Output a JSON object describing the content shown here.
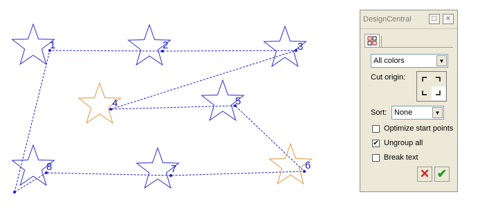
{
  "colors": {
    "blue_star": "#2b2bdb",
    "orange_star": "#e0963c",
    "path": "#1a1ad6",
    "cancel_red": "#d62020",
    "ok_green": "#1e9a1e"
  },
  "stars": [
    {
      "label": "1",
      "color": "blue"
    },
    {
      "label": "2",
      "color": "blue"
    },
    {
      "label": "3",
      "color": "blue"
    },
    {
      "label": "4",
      "color": "orange"
    },
    {
      "label": "5",
      "color": "blue"
    },
    {
      "label": "6",
      "color": "orange"
    },
    {
      "label": "7",
      "color": "blue"
    },
    {
      "label": "8",
      "color": "blue"
    }
  ],
  "panel": {
    "title": "DesignCentral",
    "tab_icon": "cut-order-icon",
    "color_filter": {
      "value": "All colors"
    },
    "cut_origin": {
      "label": "Cut origin:",
      "selected": "bottom-right"
    },
    "sort": {
      "label": "Sort:",
      "value": "None"
    },
    "options": [
      {
        "label": "Optimize start points",
        "checked": false
      },
      {
        "label": "Ungroup all",
        "checked": true
      },
      {
        "label": "Break text",
        "checked": false
      }
    ],
    "buttons": {
      "cancel_icon": "cancel-icon",
      "ok_icon": "ok-check-icon"
    }
  }
}
